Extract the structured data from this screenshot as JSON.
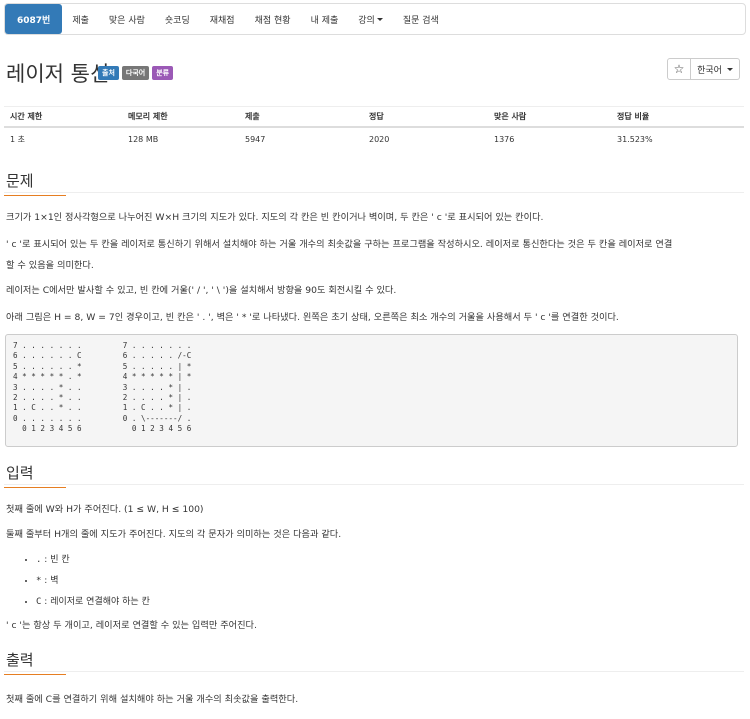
{
  "nav": {
    "items": [
      "6087번",
      "제출",
      "맞은 사람",
      "숏코딩",
      "재채점",
      "채점 현황",
      "내 제출",
      "강의",
      "질문 검색"
    ]
  },
  "problem": {
    "title": "레이저 통신",
    "labels": [
      "출처",
      "다국어",
      "분류"
    ],
    "language_button": "한국어",
    "star_icon": "☆"
  },
  "stats": {
    "headers": [
      "시간 제한",
      "메모리 제한",
      "제출",
      "정답",
      "맞은 사람",
      "정답 비율"
    ],
    "values": [
      "1 초",
      "128 MB",
      "5947",
      "2020",
      "1376",
      "31.523%"
    ]
  },
  "sections": {
    "problem_title": "문제",
    "input_title": "입력",
    "output_title": "출력"
  },
  "problem_text": {
    "p1": "크기가 1×1인 정사각형으로 나누어진 W×H 크기의 지도가 있다. 지도의 각 칸은 빈 칸이거나 벽이며, 두 칸은 ' c '로 표시되어 있는 칸이다.",
    "p2a": "' c '로 표시되어 있는 두 칸을 레이저로 통신하기 위해서 설치해야 하는 거울 개수의 최솟값을 구하는 프로그램을 작성하시오. 레이저로 통신한다는 것은 두 칸을 레이저로 연결",
    "p2b": "할 수 있음을 의미한다.",
    "p3": "레이저는 C에서만 발사할 수 있고, 빈 칸에 거울(' / ', ' \\ ')을 설치해서 방향을 90도 회전시킬 수 있다.",
    "p4": "아래 그림은 H = 8, W = 7인 경우이고, 빈 칸은 ' . ', 벽은 ' * '로 나타냈다. 왼쪽은 초기 상태, 오른쪽은 최소 개수의 거울을 사용해서 두 ' c '를 연결한 것이다."
  },
  "figure": "7 . . . . . . .         7 . . . . . . .\n6 . . . . . . C         6 . . . . . /-C\n5 . . . . . . *         5 . . . . . | *\n4 * * * * * . *         4 * * * * * | *\n3 . . . . * . .         3 . . . . * | .\n2 . . . . * . .         2 . . . . * | .\n1 . C . . * . .         1 . C . . * | .\n0 . . . . . . .         0 . \\-------/ .\n  0 1 2 3 4 5 6           0 1 2 3 4 5 6",
  "input_text": {
    "p1": "첫째 줄에 W와 H가 주어진다. (1 ≤ W, H ≤ 100)",
    "p2": "둘째 줄부터 H개의 줄에 지도가 주어진다. 지도의 각 문자가 의미하는 것은 다음과 같다.",
    "items": [
      {
        "code": ".",
        "text": ": 빈 칸"
      },
      {
        "code": "*",
        "text": ": 벽"
      },
      {
        "code": "C",
        "text": ": 레이저로 연결해야 하는 칸"
      }
    ],
    "p3": "' c '는 항상 두 개이고, 레이저로 연결할 수 있는 입력만 주어진다."
  },
  "output_text": {
    "p1": "첫째 줄에 C를 연결하기 위해 설치해야 하는 거울 개수의 최솟값을 출력한다."
  },
  "colors": {
    "nav_active": "#337ab7",
    "label_blue": "#337ab7",
    "label_gray": "#777777",
    "label_purple": "#9b59b6",
    "section_underline": "#e67e22"
  }
}
